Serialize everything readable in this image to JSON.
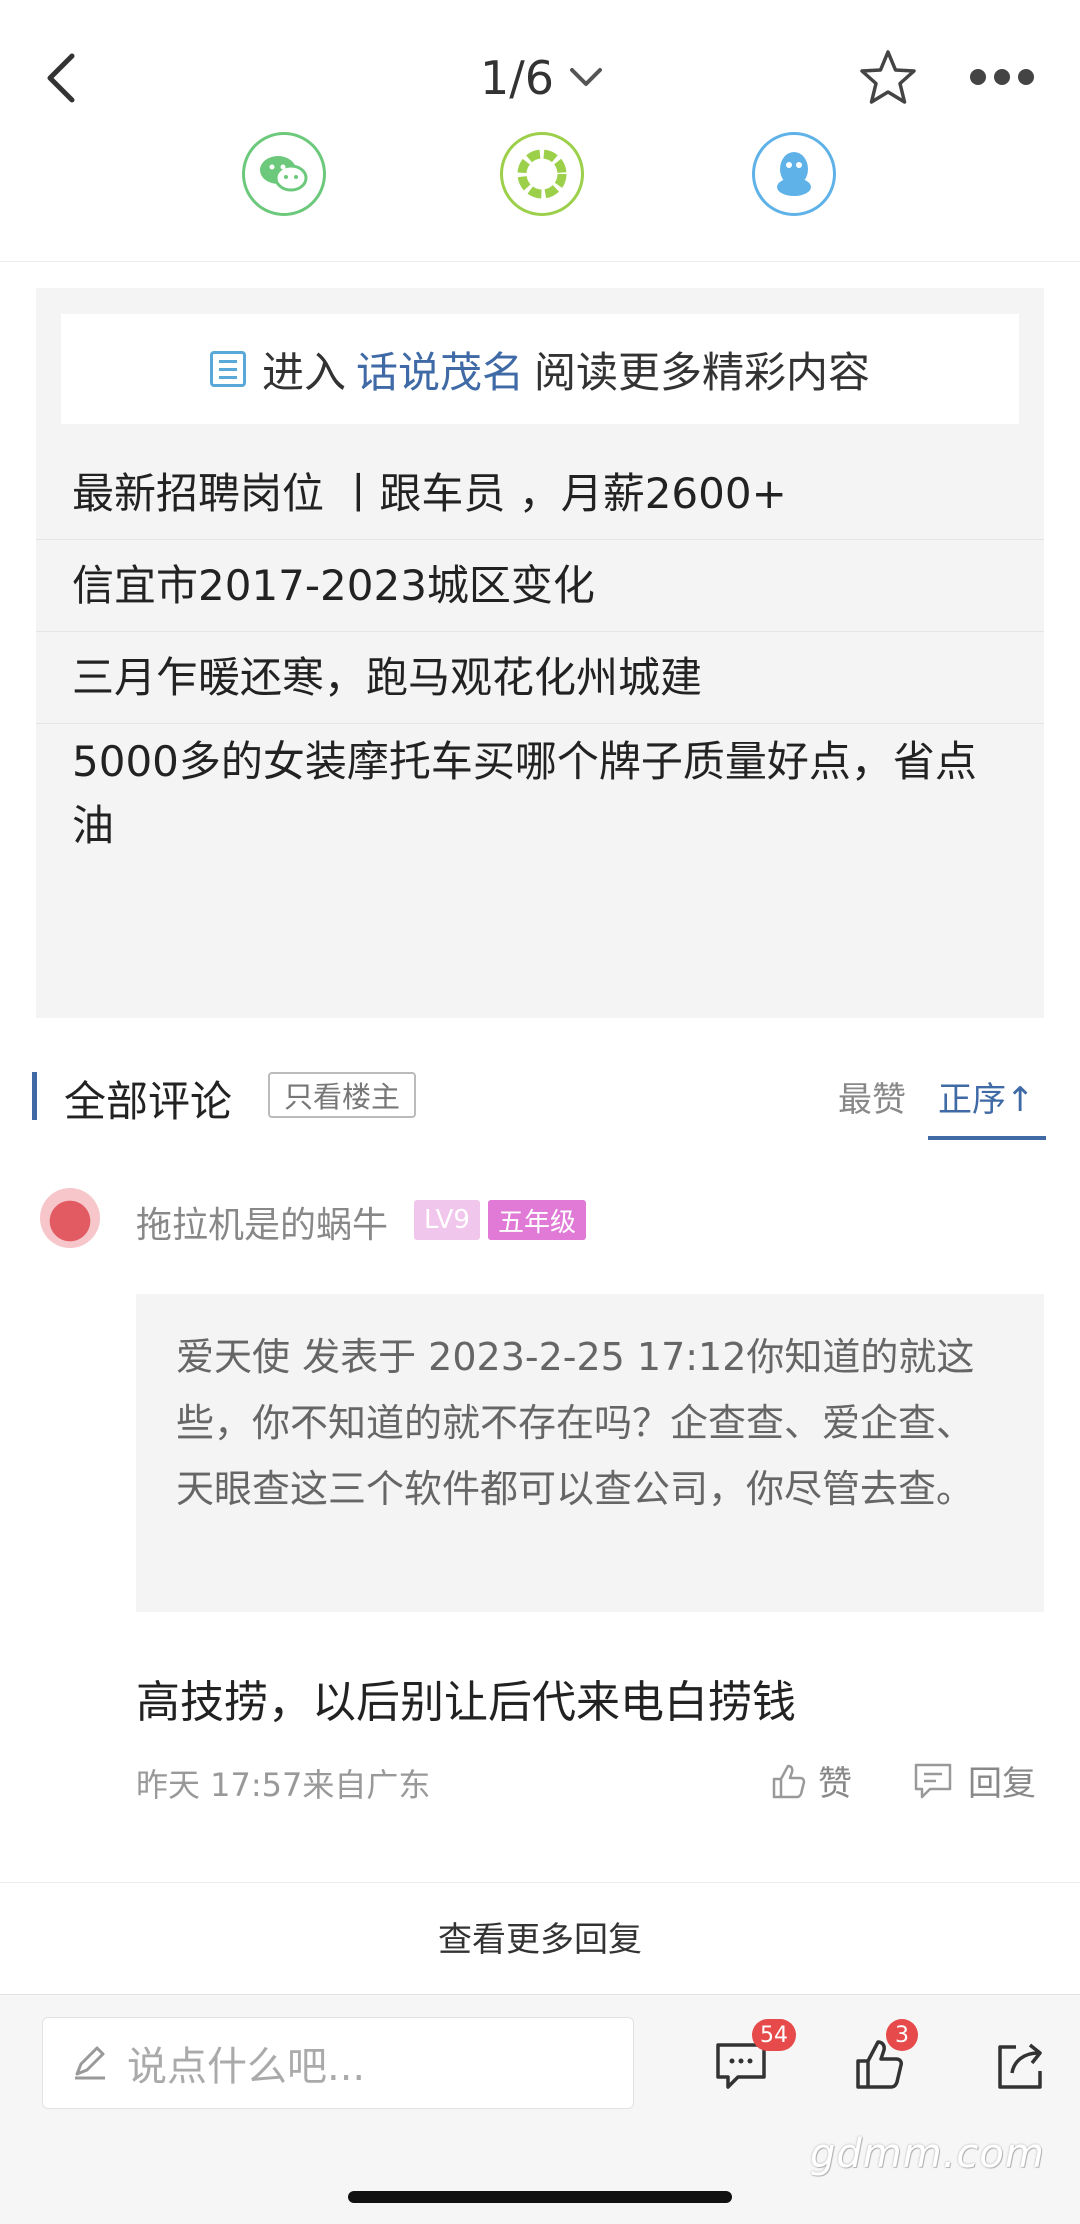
{
  "header": {
    "page_indicator": "1/6"
  },
  "share": {
    "items": [
      "wechat-icon",
      "moments-icon",
      "qq-icon"
    ]
  },
  "related": {
    "enter_prefix": "进入",
    "circle_name": "话说茂名",
    "enter_suffix": "阅读更多精彩内容",
    "items": [
      "最新招聘岗位 丨跟车员 ，月薪2600+",
      "信宜市2017-2023城区变化",
      "三月乍暖还寒，跑马观花化州城建",
      "5000多的女装摩托车买哪个牌子质量好点，省点油"
    ]
  },
  "comments": {
    "title": "全部评论",
    "only_op_label": "只看楼主",
    "sort_hot": "最赞",
    "sort_asc": "正序",
    "sort_asc_arrow": "↑",
    "first": {
      "user": "拖拉机是的蜗牛",
      "level": "LV9",
      "grade": "五年级",
      "quote": "爱天使 发表于 2023-2-25 17:12你知道的就这些，你不知道的就不存在吗？企查查、爱企查、天眼查这三个软件都可以查公司，你尽管去查。",
      "reply": "高技捞，以后别让后代来电白捞钱",
      "time": "昨天 17:57来自广东",
      "like_label": "赞",
      "reply_label": "回复"
    },
    "more_replies": "查看更多回复"
  },
  "bottom": {
    "input_placeholder": "说点什么吧...",
    "comment_count": "54",
    "like_count": "3"
  },
  "watermark": "gdmm.com",
  "colors": {
    "accent": "#3f6aa6",
    "badge_red": "#e64a4a",
    "grade_pink": "#e07ad6"
  }
}
